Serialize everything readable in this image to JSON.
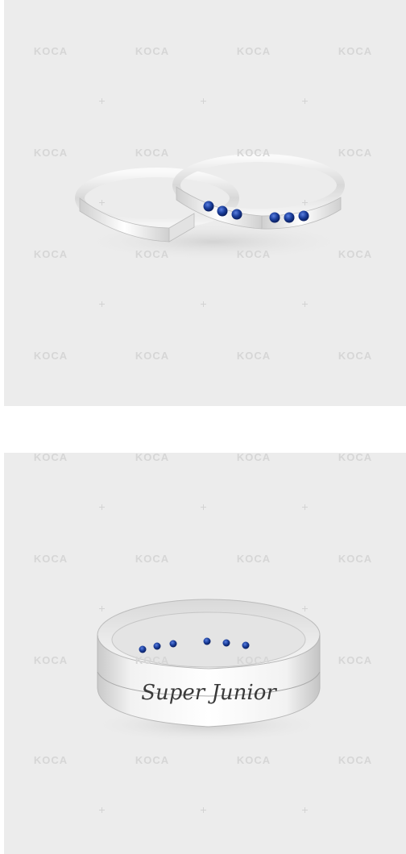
{
  "watermark": {
    "text": "KOCA"
  },
  "top_photo": {
    "subject": "two silver stacked rings with blue stones",
    "colors": {
      "background": "#ececec",
      "silver": "#e6e6e6",
      "stone": "#1a3d9a"
    }
  },
  "bottom_photo": {
    "subject": "silver ring with engraved outer band",
    "engraving": "Super Junior",
    "colors": {
      "background": "#ececec",
      "silver": "#e3e3e3",
      "stone": "#1a3d9a"
    }
  }
}
